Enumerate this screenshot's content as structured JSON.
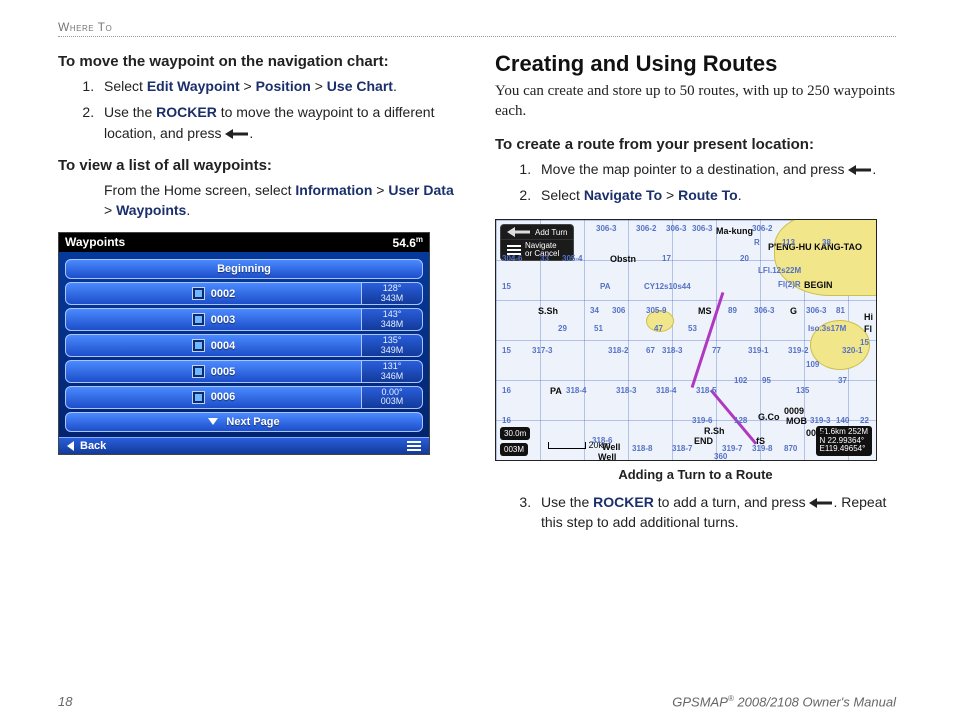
{
  "header": {
    "section": "Where To"
  },
  "left": {
    "task1_title": "To move the waypoint on the navigation chart:",
    "step1_a": "Select ",
    "step1_b": "Edit Waypoint",
    "step1_c": " > ",
    "step1_d": "Position",
    "step1_e": " > ",
    "step1_f": "Use Chart",
    "step1_g": ".",
    "step2_a": "Use the ",
    "step2_b": "ROCKER",
    "step2_c": " to move the waypoint to a different location, and press ",
    "step2_d": ".",
    "task2_title": "To view a list of all waypoints:",
    "note_a": "From the Home screen, select ",
    "note_b": "Information",
    "note_c": " > ",
    "note_d": "User Data",
    "note_e": " > ",
    "note_f": "Waypoints",
    "note_g": "."
  },
  "device1": {
    "title": "Waypoints",
    "depth": "54.6",
    "depth_unit": "m",
    "rows": [
      {
        "label": "Beginning",
        "l1": "",
        "l2": ""
      },
      {
        "label": "0002",
        "l1": "128°",
        "l2": "343M"
      },
      {
        "label": "0003",
        "l1": "143°",
        "l2": "348M"
      },
      {
        "label": "0004",
        "l1": "135°",
        "l2": "349M"
      },
      {
        "label": "0005",
        "l1": "131°",
        "l2": "346M"
      },
      {
        "label": "0006",
        "l1": "0.00°",
        "l2": "003M"
      }
    ],
    "next_page": "Next Page",
    "back": "Back"
  },
  "right": {
    "heading": "Creating and Using Routes",
    "intro": "You can create and store up to 50 routes, with up to 250 waypoints each.",
    "task1_title": "To create a route from your present location:",
    "s1_a": "Move the map pointer to a destination, and press ",
    "s1_b": ".",
    "s2_a": "Select ",
    "s2_b": "Navigate To",
    "s2_c": " > ",
    "s2_d": "Route To",
    "s2_e": ".",
    "caption": "Adding a Turn to a Route",
    "s3_a": "Use the ",
    "s3_b": "ROCKER",
    "s3_c": " to add a turn, and press ",
    "s3_d": ". Repeat this step to add additional turns."
  },
  "device2": {
    "menu1": "Add Turn",
    "menu2a": "Navigate",
    "menu2b": "or Cancel",
    "scale": "20km",
    "depth_box": "30.0m",
    "heading_box": "003M",
    "info1": "51.6km 252M",
    "info2": "N 22.99364°",
    "info3": "E119.49654°",
    "begin": "BEGIN",
    "end": "END",
    "mob": "MOB",
    "makung": "Ma-kung",
    "obstn": "Obstn",
    "well1": "Well",
    "well2": "Well",
    "penghu": "P'ENG-HU KANG-TAO",
    "cells": {
      "a": "306-3",
      "b": "306-2",
      "c": "306-3",
      "d": "306-3",
      "e": "306-2",
      "f": "304-6",
      "g": "33",
      "h": "305-4",
      "i": "17",
      "j": "R",
      "k": "113",
      "l": "38",
      "m": "20",
      "n": "LFl.12s22M",
      "o": "PA",
      "p": "CY12s10s44",
      "q": "Fl(2)R",
      "r": "15",
      "s": "S.Sh",
      "t": "34",
      "u": "306",
      "v": "305-9",
      "w": "MS",
      "x": "89",
      "y": "306-3",
      "z": "G",
      "aa": "306-3",
      "ab": "81",
      "ac": "29",
      "ad": "51",
      "ae": "47",
      "af": "53",
      "ag": "Iso.3s17M",
      "ah": "Hi",
      "ai": "Fl",
      "aj": "15",
      "ak": "317-3",
      "al": "318-2",
      "am": "67",
      "an": "318-3",
      "ao": "77",
      "ap": "319-1",
      "aq": "319-2",
      "ar": "109",
      "as": "320-1",
      "at": "15",
      "au": "16",
      "av": "PA",
      "aw": "318-4",
      "ax": "318-3",
      "ay": "318-4",
      "az": "318-5",
      "ba": "102",
      "bb": "95",
      "bc": "135",
      "bd": "37",
      "be": "16",
      "bf": "319-6",
      "bg": "128",
      "bh": "G.Co",
      "bi": "0009",
      "bj": "319-3",
      "bk": "140",
      "bl": "22",
      "bm": "318-6",
      "bn": "318-8",
      "bo": "R.Sh",
      "bp": "318-7",
      "bq": "319-7",
      "br": "319-8",
      "bs": "870",
      "bt": "fS",
      "bu": "360",
      "bv": "0006"
    }
  },
  "footer": {
    "page": "18",
    "brand": "GPSMAP",
    "reg": "®",
    "rest": " 2008/2108  Owner's Manual"
  }
}
